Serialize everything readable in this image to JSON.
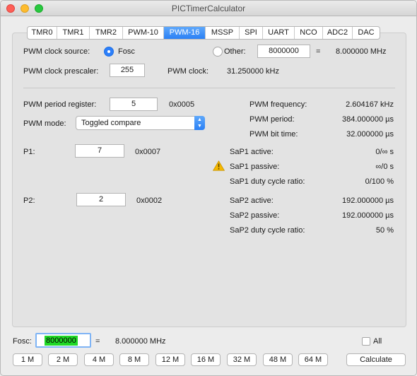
{
  "window": {
    "title": "PICTimerCalculator"
  },
  "tabs": [
    {
      "label": "TMR0"
    },
    {
      "label": "TMR1"
    },
    {
      "label": "TMR2"
    },
    {
      "label": "PWM-10"
    },
    {
      "label": "PWM-16"
    },
    {
      "label": "MSSP"
    },
    {
      "label": "SPI"
    },
    {
      "label": "UART"
    },
    {
      "label": "NCO"
    },
    {
      "label": "ADC2"
    },
    {
      "label": "DAC"
    }
  ],
  "active_tab": "PWM-16",
  "clock": {
    "source_label": "PWM clock source:",
    "fosc_option": "Fosc",
    "other_option": "Other:",
    "other_value": "8000000",
    "equals": "=",
    "other_freq": "8.000000 MHz",
    "prescaler_label": "PWM clock prescaler:",
    "prescaler_value": "255",
    "pwm_clock_label": "PWM clock:",
    "pwm_clock_value": "31.250000 kHz"
  },
  "period": {
    "label": "PWM period register:",
    "value": "5",
    "hex": "0x0005",
    "mode_label": "PWM mode:",
    "mode_value": "Toggled compare"
  },
  "stats": {
    "frequency_label": "PWM frequency:",
    "frequency_value": "2.604167 kHz",
    "period_label": "PWM period:",
    "period_value": "384.000000 µs",
    "bit_time_label": "PWM bit time:",
    "bit_time_value": "32.000000 µs"
  },
  "p1": {
    "label": "P1:",
    "value": "7",
    "hex": "0x0007",
    "active_label": "SaP1 active:",
    "active_value": "0/∞ s",
    "passive_label": "SaP1 passive:",
    "passive_value": "∞/0 s",
    "duty_label": "SaP1 duty cycle ratio:",
    "duty_value": "0/100 %"
  },
  "p2": {
    "label": "P2:",
    "value": "2",
    "hex": "0x0002",
    "active_label": "SaP2 active:",
    "active_value": "192.000000 µs",
    "passive_label": "SaP2 passive:",
    "passive_value": "192.000000 µs",
    "duty_label": "SaP2 duty cycle ratio:",
    "duty_value": "50 %"
  },
  "footer": {
    "fosc_label": "Fosc:",
    "fosc_value": "8000000",
    "equals": "=",
    "fosc_freq": "8.000000 MHz",
    "all_label": "All",
    "presets": [
      "1 M",
      "2 M",
      "4 M",
      "8 M",
      "12 M",
      "16 M",
      "32 M",
      "48 M",
      "64 M"
    ],
    "calculate_label": "Calculate"
  },
  "colors": {
    "accent": "#2a80f5",
    "highlight": "#20d927",
    "warning": "#f5b800"
  },
  "icons": {
    "warning": "warning-triangle-icon",
    "select_arrow": "updown-chevron-icon"
  }
}
